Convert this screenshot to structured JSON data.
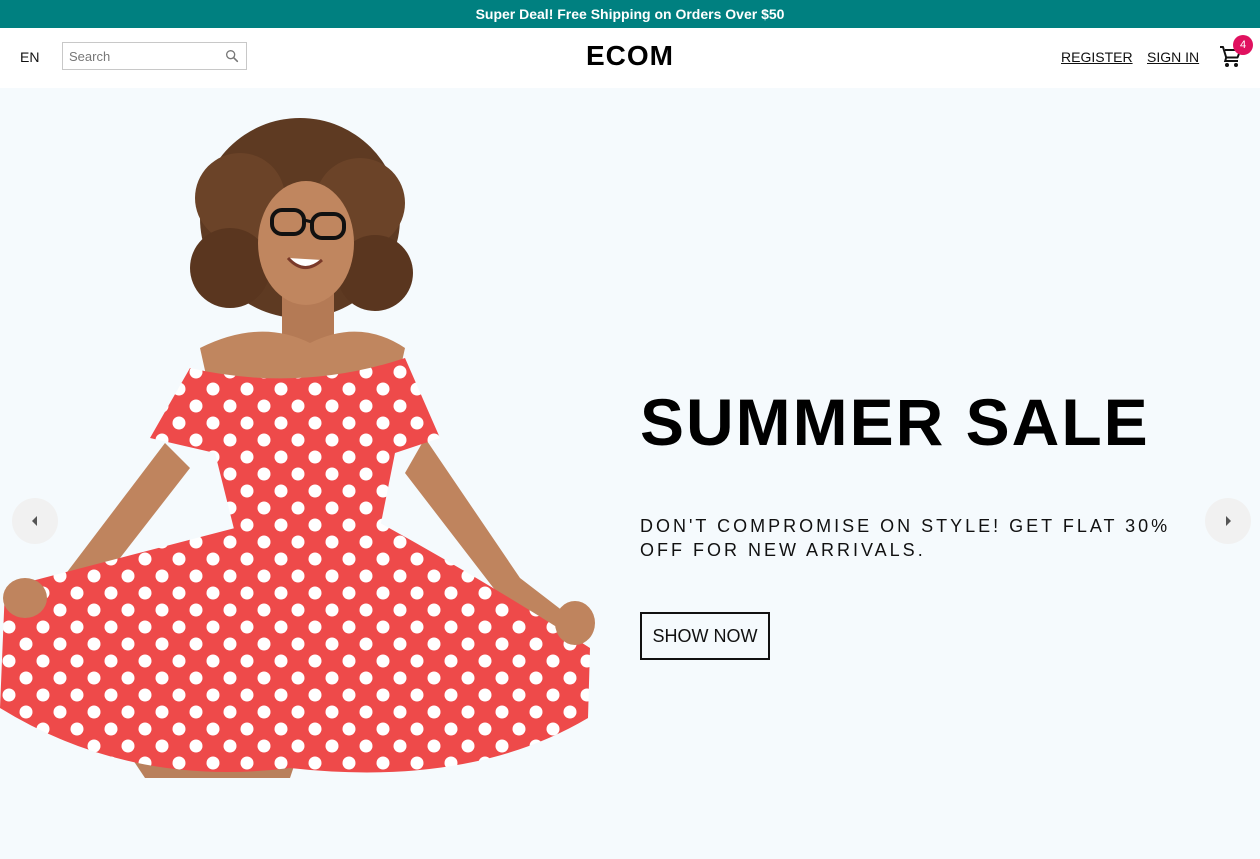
{
  "announcement": {
    "text": "Super Deal! Free Shipping on Orders Over $50"
  },
  "header": {
    "language": "EN",
    "search": {
      "placeholder": "Search",
      "value": ""
    },
    "logo": "ECOM",
    "register_label": "REGISTER",
    "signin_label": "SIGN IN",
    "cart_count": "4"
  },
  "hero": {
    "title": "SUMMER SALE",
    "description": "DON'T COMPROMISE ON STYLE! GET FLAT 30% OFF FOR NEW ARRIVALS.",
    "button_label": "SHOW NOW"
  },
  "icons": {
    "search": "search-icon",
    "cart": "shopping-cart-icon",
    "prev": "arrow-left-icon",
    "next": "arrow-right-icon"
  },
  "colors": {
    "announcement_bg": "#008080",
    "badge": "#e0115f",
    "hero_bg": "#f5fafd",
    "dress": "#ee4a4a"
  }
}
